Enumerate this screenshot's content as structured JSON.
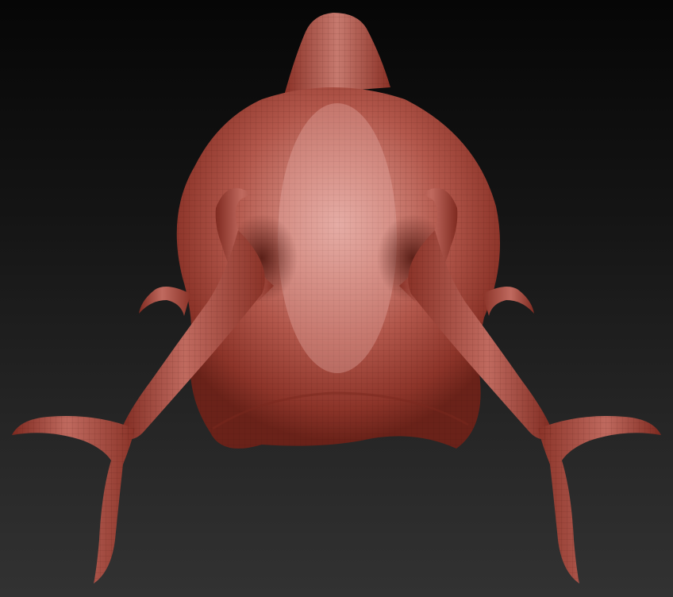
{
  "scene": {
    "background": {
      "top": "#060606",
      "bottom": "#323232"
    },
    "model": {
      "name": "sculpt-model",
      "material_color": "#a8473b",
      "highlight_color": "#e9b1a9",
      "shadow_color": "#5a1a14",
      "wireframe": true,
      "view": "top"
    }
  }
}
